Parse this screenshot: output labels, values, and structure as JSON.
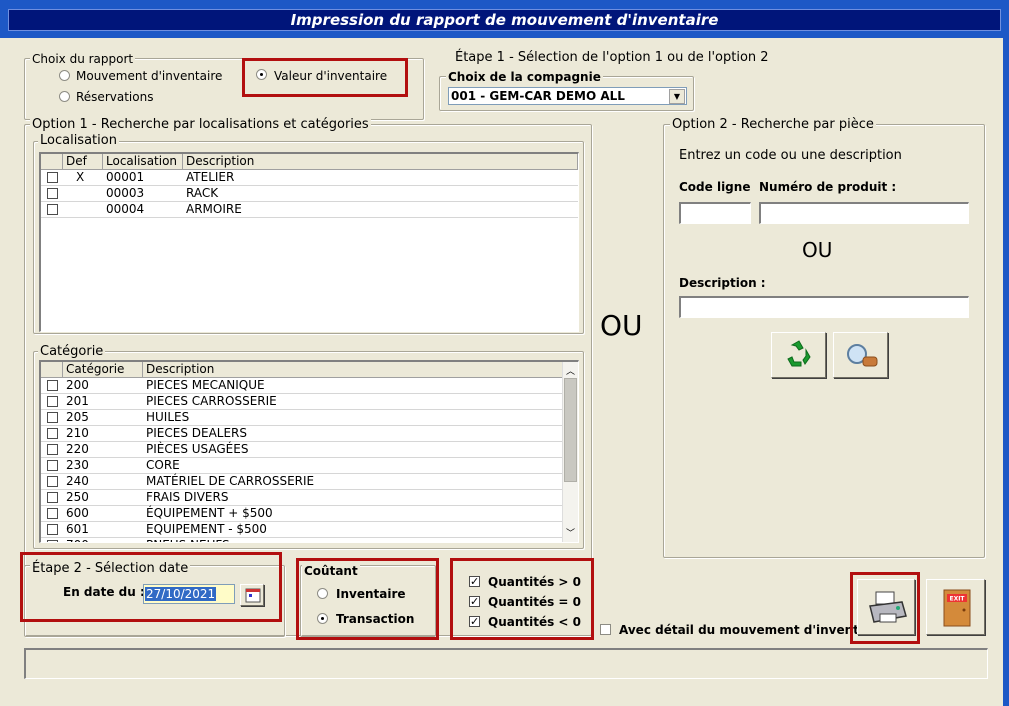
{
  "window": {
    "title": "Impression du rapport de mouvement d'inventaire"
  },
  "report_choice": {
    "label": "Choix du rapport",
    "options": [
      "Mouvement d'inventaire",
      "Valeur d'inventaire",
      "Réservations"
    ],
    "selected": "Valeur d'inventaire"
  },
  "step1": {
    "heading": "Étape 1 - Sélection de l'option 1 ou de l'option 2",
    "company_label": "Choix de la compagnie",
    "company_value": "001 - GEM-CAR DEMO ALL"
  },
  "option1": {
    "label": "Option 1 - Recherche par localisations et catégories",
    "localisation": {
      "label": "Localisation",
      "columns": [
        "Def",
        "Localisation",
        "Description"
      ],
      "rows": [
        {
          "def": "X",
          "code": "00001",
          "description": "ATELIER"
        },
        {
          "def": "",
          "code": "00003",
          "description": "RACK"
        },
        {
          "def": "",
          "code": "00004",
          "description": "ARMOIRE"
        }
      ]
    },
    "categorie": {
      "label": "Catégorie",
      "columns": [
        "Catégorie",
        "Description"
      ],
      "rows": [
        {
          "code": "200",
          "description": "PIECES MECANIQUE"
        },
        {
          "code": "201",
          "description": "PIECES CARROSSERIE"
        },
        {
          "code": "205",
          "description": "HUILES"
        },
        {
          "code": "210",
          "description": "PIECES DEALERS"
        },
        {
          "code": "220",
          "description": "PIÈCES USAGÉES"
        },
        {
          "code": "230",
          "description": "CORE"
        },
        {
          "code": "240",
          "description": "MATÉRIEL DE CARROSSERIE"
        },
        {
          "code": "250",
          "description": "FRAIS DIVERS"
        },
        {
          "code": "600",
          "description": "ÉQUIPEMENT + $500"
        },
        {
          "code": "601",
          "description": "EQUIPEMENT - $500"
        },
        {
          "code": "700",
          "description": "PNEUS NEUFS"
        }
      ]
    }
  },
  "ou_big": "OU",
  "option2": {
    "label": "Option 2 - Recherche par pièce",
    "instruction": "Entrez un code ou une description",
    "code_ligne_label": "Code ligne",
    "numero_label": "Numéro de produit :",
    "ou": "OU",
    "description_label": "Description :"
  },
  "step2": {
    "label": "Étape 2 - Sélection date",
    "date_label": "En date du :",
    "date_value": "27/10/2021"
  },
  "coutant": {
    "label": "Coûtant",
    "options": [
      "Inventaire",
      "Transaction"
    ],
    "selected": "Transaction"
  },
  "quantities": [
    "Quantités > 0",
    "Quantités = 0",
    "Quantités < 0"
  ],
  "detail_label": "Avec détail du mouvement d'inventaire",
  "exit_label": "EXIT",
  "colors": {
    "title_bg": "#00157a",
    "frame": "#1d58c6",
    "highlight": "#b20f0f",
    "date_bg": "#316ac5"
  }
}
